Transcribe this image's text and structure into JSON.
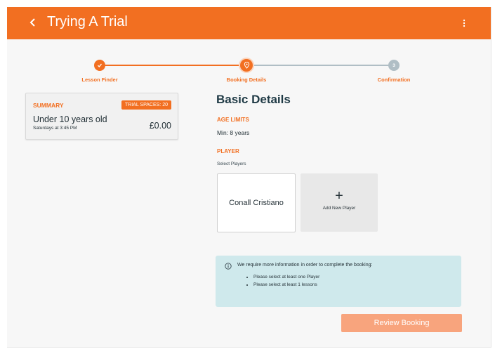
{
  "header": {
    "title": "Trying A Trial",
    "back_icon": "chevron-left-icon",
    "menu_icon": "more-vertical-icon",
    "bar_color": "#f26f21"
  },
  "stepper": {
    "steps": [
      {
        "label": "Lesson Finder",
        "state": "completed",
        "icon": "check-icon"
      },
      {
        "label": "Booking Details",
        "state": "active",
        "icon": "location-pin-icon"
      },
      {
        "label": "Confirmation",
        "state": "upcoming",
        "number": "3"
      }
    ]
  },
  "summary": {
    "heading": "SUMMARY",
    "badge": "TRIAL SPACES: 20",
    "lesson_name": "Under 10 years old",
    "schedule": "Saturdays at 3:45 PM",
    "price": "£0.00"
  },
  "details": {
    "title": "Basic Details",
    "age_heading": "AGE LIMITS",
    "age_value": "Min: 8 years",
    "player_heading": "PLAYER",
    "player_hint": "Select Players",
    "players": [
      "Conall Cristiano"
    ],
    "add_player_symbol": "+",
    "add_player_label": "Add New Player"
  },
  "notice": {
    "icon": "info-icon",
    "message": "We require more information in order to complete the booking:",
    "items": [
      "Please select at least one Player",
      "Please select at least 1 lessons"
    ],
    "background": "#cfe9ec"
  },
  "actions": {
    "review_label": "Review Booking",
    "review_color": "#f8a47d"
  }
}
